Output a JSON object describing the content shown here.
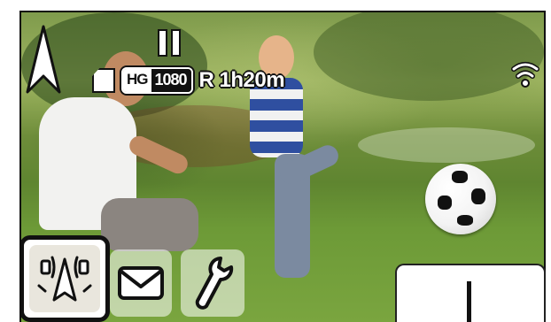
{
  "status": {
    "media_icon": "sd-card-icon",
    "quality_mode": "HG",
    "resolution": "1080",
    "remaining_label": "R 1h20m"
  },
  "icons": {
    "compass": "north-arrow-icon",
    "pause": "pause-icon",
    "wireless": "wifi-icon"
  },
  "buttons": [
    {
      "name": "wireless-multi-camera-button",
      "icon": "wireless-camera-icon",
      "selected": true
    },
    {
      "name": "message-button",
      "icon": "envelope-icon",
      "selected": false
    },
    {
      "name": "setup-button",
      "icon": "wrench-icon",
      "selected": false
    },
    {
      "name": "blank-callout-button",
      "icon": "",
      "selected": false
    }
  ],
  "colors": {
    "overlay_outline": "#111111",
    "overlay_fill": "#ffffff",
    "grass": "#6d9a37"
  }
}
